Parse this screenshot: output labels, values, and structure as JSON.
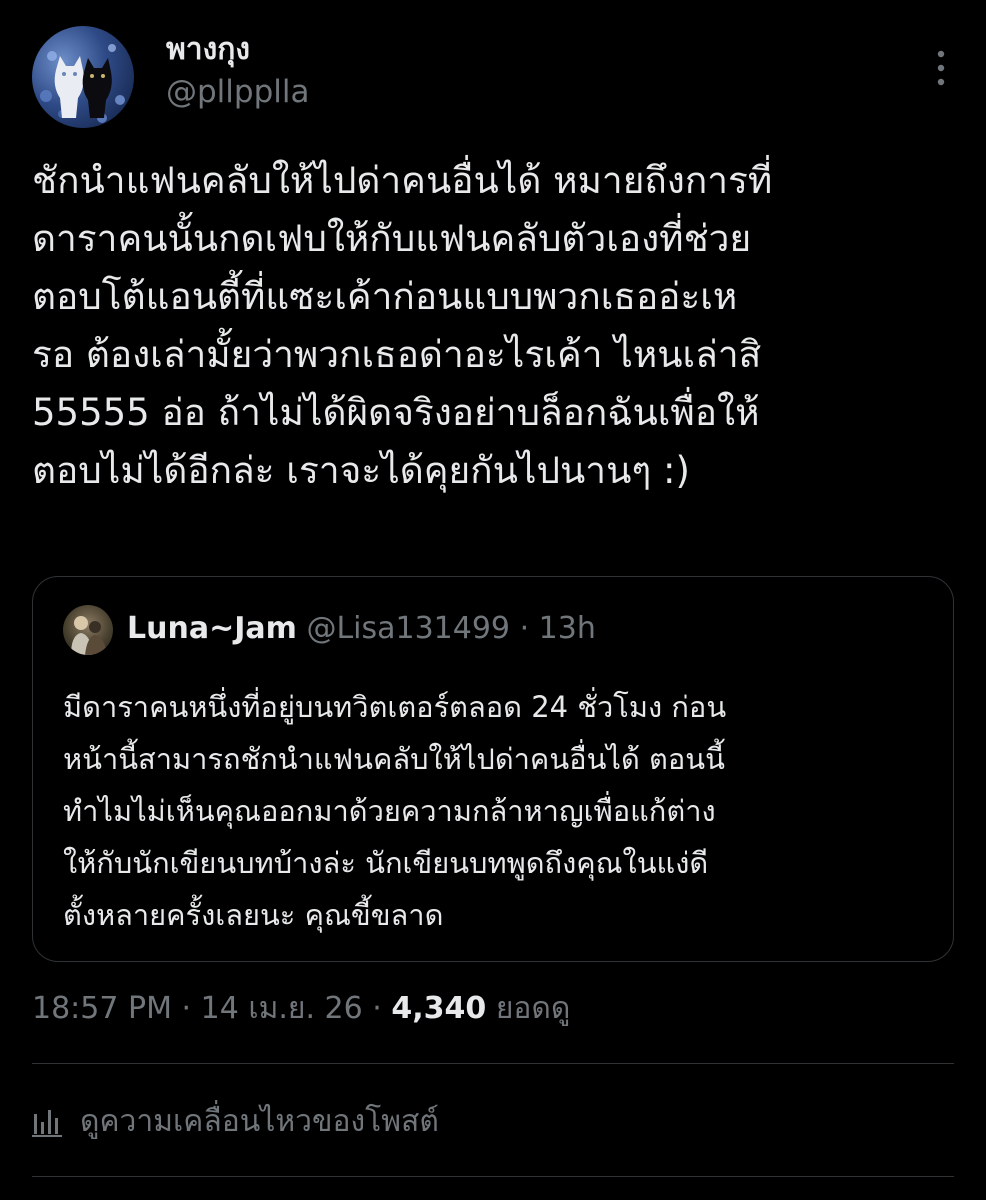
{
  "author": {
    "display_name": "พางกุง",
    "handle": "@pllpplla"
  },
  "tweet": {
    "lines": [
      "ชักนำแฟนคลับให้ไปด่าคนอื่นได้ หมายถึงการที่",
      "ดาราคนนั้นกดเฟบให้กับแฟนคลับตัวเองที่ช่วย",
      "ตอบโต้แอนตี้ที่แซะเค้าก่อนแบบพวกเธออ่ะเห",
      "รอ ต้องเล่ามั้ยว่าพวกเธอด่าอะไรเค้า ไหนเล่าสิ",
      "55555 อ่อ ถ้าไม่ได้ผิดจริงอย่าบล็อกฉันเพื่อให้",
      "ตอบไม่ได้อีกล่ะ เราจะได้คุยกันไปนานๆ  :)"
    ]
  },
  "quote": {
    "display_name": "Luna~Jam",
    "handle": "@Lisa131499",
    "separator": "·",
    "time": "13h",
    "lines": [
      "มีดาราคนหนึ่งที่อยู่บนทวิตเตอร์ตลอด 24 ชั่วโมง ก่อน",
      "หน้านี้สามารถชักนำแฟนคลับให้ไปด่าคนอื่นได้ ตอนนี้",
      "ทำไมไม่เห็นคุณออกมาด้วยความกล้าหาญเพื่อแก้ต่าง",
      "ให้กับนักเขียนบทบ้างล่ะ นักเขียนบทพูดถึงคุณในแง่ดี",
      "ตั้งหลายครั้งเลยนะ  คุณขี้ขลาด"
    ]
  },
  "meta": {
    "time": "18:57 PM",
    "separator": "·",
    "date": "14 เม.ย. 26",
    "views_count": "4,340",
    "views_label": "ยอดดู"
  },
  "analytics": {
    "label": "ดูความเคลื่อนไหวของโพสต์",
    "icon": "analytics-bar-chart-icon"
  },
  "colors": {
    "background": "#000000",
    "primary_text": "#e7e9ea",
    "secondary_text": "#71767b",
    "border": "#2f3336"
  }
}
